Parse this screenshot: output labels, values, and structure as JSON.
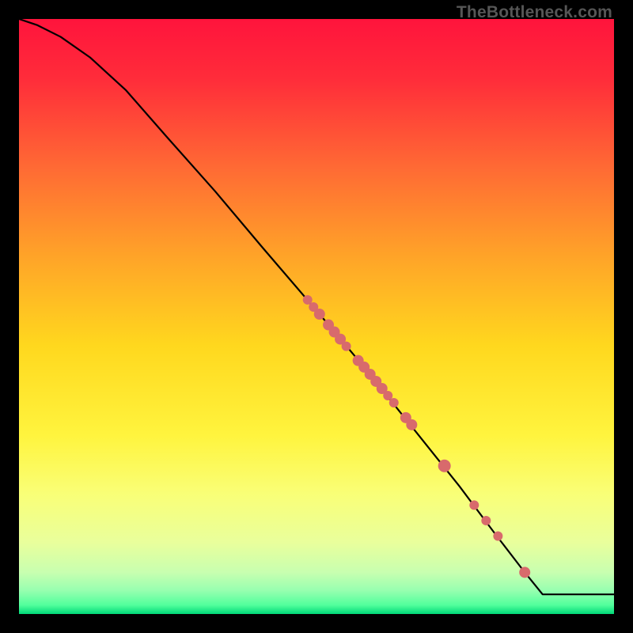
{
  "watermark": "TheBottleneck.com",
  "chart_data": {
    "type": "line",
    "title": "",
    "xlabel": "",
    "ylabel": "",
    "xlim": [
      0,
      100
    ],
    "ylim": [
      0,
      100
    ],
    "grid": false,
    "legend": false,
    "background_gradient_stops": [
      {
        "offset": 0.0,
        "color": "#ff143c"
      },
      {
        "offset": 0.1,
        "color": "#ff2c3a"
      },
      {
        "offset": 0.25,
        "color": "#ff6a34"
      },
      {
        "offset": 0.4,
        "color": "#ffa428"
      },
      {
        "offset": 0.55,
        "color": "#ffd81e"
      },
      {
        "offset": 0.7,
        "color": "#fff43e"
      },
      {
        "offset": 0.8,
        "color": "#f9ff78"
      },
      {
        "offset": 0.88,
        "color": "#e9ff9c"
      },
      {
        "offset": 0.93,
        "color": "#c8ffb0"
      },
      {
        "offset": 0.96,
        "color": "#98ffb0"
      },
      {
        "offset": 0.985,
        "color": "#52ff9c"
      },
      {
        "offset": 1.0,
        "color": "#00d878"
      }
    ],
    "series": [
      {
        "name": "curve",
        "stroke": "#000000",
        "x": [
          0,
          3,
          7,
          12,
          18,
          25,
          33,
          41,
          50,
          58,
          66,
          74,
          80,
          85,
          88,
          100
        ],
        "y": [
          100,
          99,
          97,
          93.5,
          88,
          80,
          71,
          61.5,
          51,
          41.5,
          31.5,
          21.5,
          13.5,
          7,
          3.3,
          3.3
        ]
      }
    ],
    "markers": {
      "color": "#d86a6c",
      "points": [
        {
          "x": 48.5,
          "y": 52.8,
          "r": 6
        },
        {
          "x": 49.5,
          "y": 51.6,
          "r": 6
        },
        {
          "x": 50.5,
          "y": 50.4,
          "r": 7
        },
        {
          "x": 52.0,
          "y": 48.6,
          "r": 7
        },
        {
          "x": 53.0,
          "y": 47.4,
          "r": 7
        },
        {
          "x": 54.0,
          "y": 46.2,
          "r": 7
        },
        {
          "x": 55.0,
          "y": 45.0,
          "r": 6
        },
        {
          "x": 57.0,
          "y": 42.6,
          "r": 7
        },
        {
          "x": 58.0,
          "y": 41.5,
          "r": 7
        },
        {
          "x": 59.0,
          "y": 40.3,
          "r": 7
        },
        {
          "x": 60.0,
          "y": 39.1,
          "r": 7
        },
        {
          "x": 61.0,
          "y": 37.9,
          "r": 7
        },
        {
          "x": 62.0,
          "y": 36.7,
          "r": 6
        },
        {
          "x": 63.0,
          "y": 35.5,
          "r": 6
        },
        {
          "x": 65.0,
          "y": 33.0,
          "r": 7
        },
        {
          "x": 66.0,
          "y": 31.8,
          "r": 7
        },
        {
          "x": 71.5,
          "y": 24.9,
          "r": 8
        },
        {
          "x": 76.5,
          "y": 18.3,
          "r": 6
        },
        {
          "x": 78.5,
          "y": 15.7,
          "r": 6
        },
        {
          "x": 80.5,
          "y": 13.1,
          "r": 6
        },
        {
          "x": 85.0,
          "y": 7.0,
          "r": 7
        }
      ]
    }
  }
}
